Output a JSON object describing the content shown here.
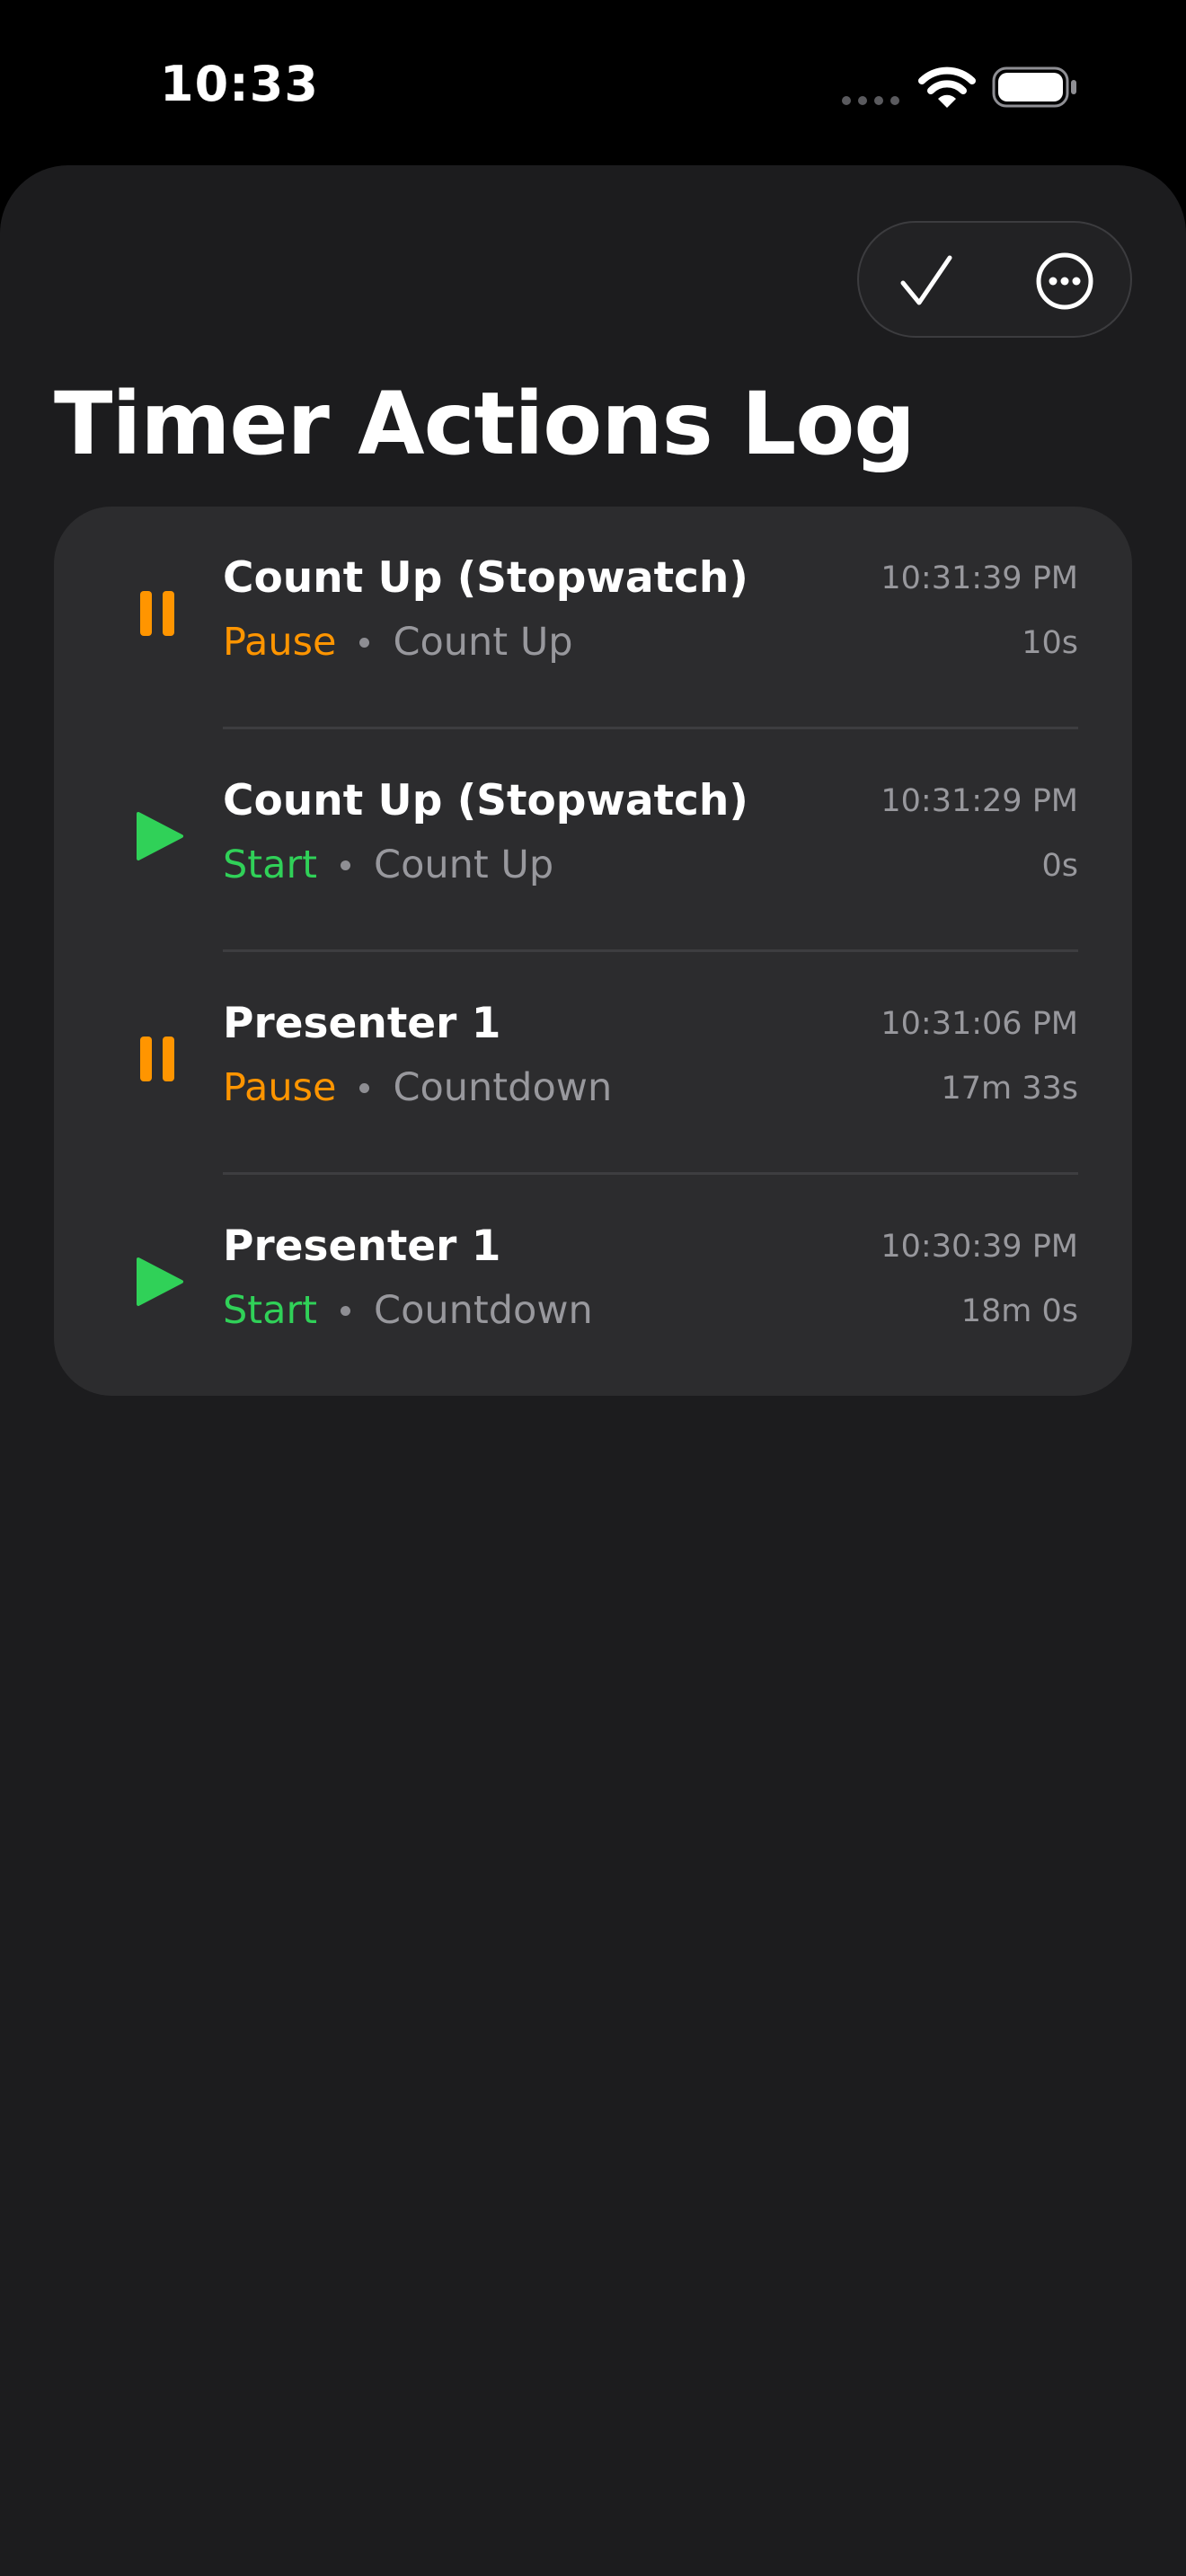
{
  "status_bar": {
    "time": "10:33"
  },
  "toolbar": {
    "done_icon": "checkmark-icon",
    "more_icon": "ellipsis-circle-icon"
  },
  "page": {
    "title": "Timer Actions Log"
  },
  "colors": {
    "pause": "#ff9500",
    "start": "#30d158",
    "sheet_background": "#1c1c1e",
    "card_background": "#2c2c2e"
  },
  "log_entries": [
    {
      "icon": "pause-icon",
      "title": "Count Up (Stopwatch)",
      "action": "Pause",
      "timer_type": "Count Up",
      "time": "10:31:39 PM",
      "elapsed": "10s"
    },
    {
      "icon": "play-icon",
      "title": "Count Up (Stopwatch)",
      "action": "Start",
      "timer_type": "Count Up",
      "time": "10:31:29 PM",
      "elapsed": "0s"
    },
    {
      "icon": "pause-icon",
      "title": "Presenter 1",
      "action": "Pause",
      "timer_type": "Countdown",
      "time": "10:31:06 PM",
      "elapsed": "17m 33s"
    },
    {
      "icon": "play-icon",
      "title": "Presenter 1",
      "action": "Start",
      "timer_type": "Countdown",
      "time": "10:30:39 PM",
      "elapsed": "18m 0s"
    }
  ]
}
